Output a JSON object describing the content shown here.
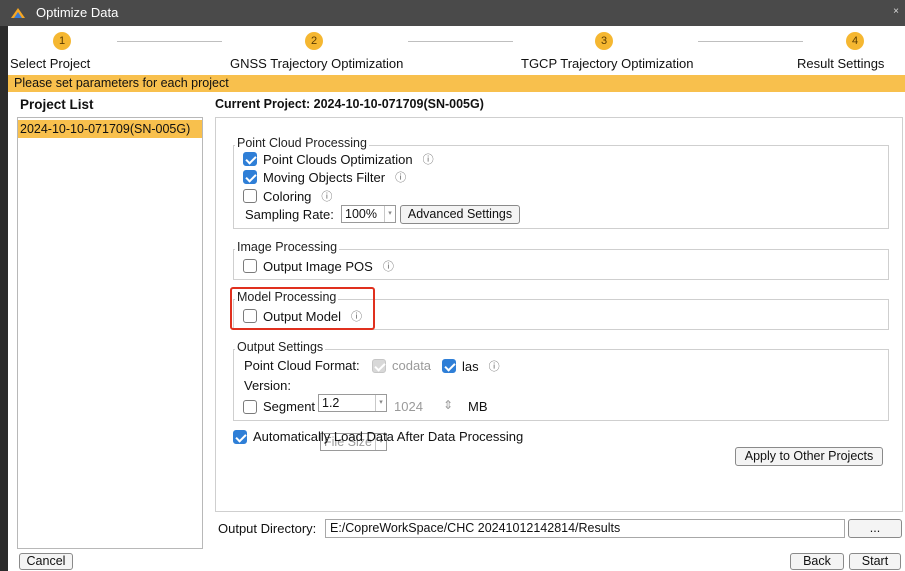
{
  "window": {
    "title": "Optimize Data",
    "close_glyph": "×",
    "app_icon": "app-logo-icon"
  },
  "steps": [
    {
      "number": "1",
      "label": "Select Project"
    },
    {
      "number": "2",
      "label": "GNSS Trajectory Optimization"
    },
    {
      "number": "3",
      "label": "TGCP Trajectory Optimization"
    },
    {
      "number": "4",
      "label": "Result Settings"
    }
  ],
  "banner": "Please set parameters for each project",
  "project_list": {
    "title": "Project List",
    "items": [
      "2024-10-10-071709(SN-005G)"
    ]
  },
  "current_project": "Current Project: 2024-10-10-071709(SN-005G)",
  "point_cloud": {
    "legend": "Point Cloud Processing",
    "optimization": {
      "label": "Point Clouds Optimization",
      "checked": true
    },
    "moving_filter": {
      "label": "Moving Objects Filter",
      "checked": true
    },
    "coloring": {
      "label": "Coloring",
      "checked": false
    },
    "sampling_label": "Sampling Rate:",
    "sampling_value": "100%",
    "advanced_button": "Advanced Settings"
  },
  "image": {
    "legend": "Image Processing",
    "output_pos": {
      "label": "Output Image POS",
      "checked": false
    }
  },
  "model": {
    "legend": "Model Processing",
    "output_model": {
      "label": "Output Model",
      "checked": false
    }
  },
  "output_settings": {
    "legend": "Output Settings",
    "format_label": "Point Cloud Format:",
    "codata": {
      "label": "codata",
      "checked": true,
      "disabled": true
    },
    "las": {
      "label": "las",
      "checked": true
    },
    "version_label": "Version:",
    "version_value": "1.2",
    "segment": {
      "label": "Segment",
      "checked": false
    },
    "segment_mode": "File Size",
    "segment_size": "1024",
    "segment_unit": "MB"
  },
  "auto_load": {
    "label": "Automatically Load Data After Data Processing",
    "checked": true
  },
  "apply_button": "Apply to Other Projects",
  "output_directory": {
    "label": "Output Directory:",
    "value": "E:/CopreWorkSpace/CHC 20241012142814/Results",
    "browse": "..."
  },
  "footer": {
    "cancel": "Cancel",
    "back": "Back",
    "start": "Start"
  },
  "info_glyph": "ⓘ",
  "spinner_glyph": "⇕",
  "dropdown_glyph": "▾",
  "colors": {
    "accent": "#f8c04d",
    "step": "#f5b731",
    "checkbox": "#2f7fd7",
    "highlight": "#e0301e"
  }
}
